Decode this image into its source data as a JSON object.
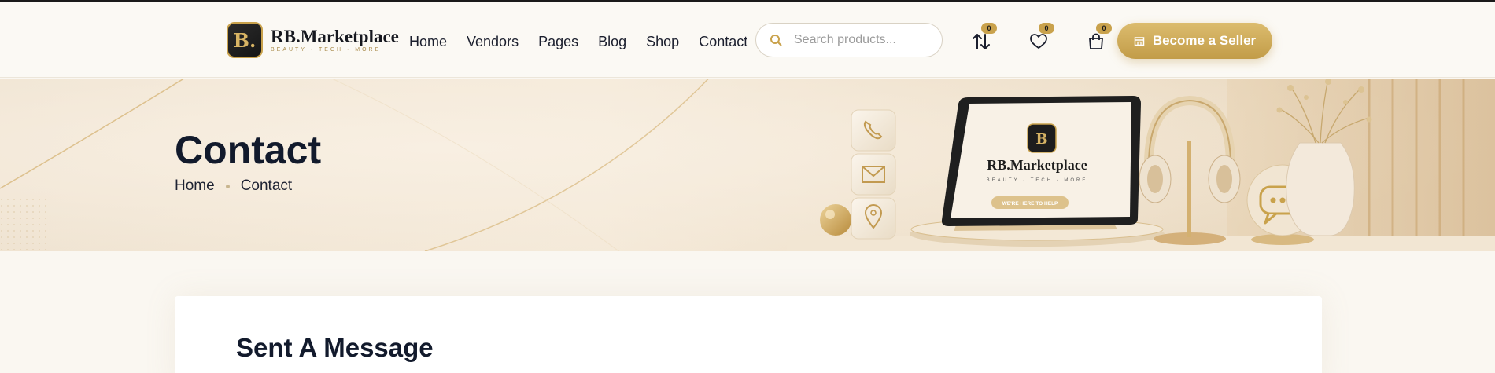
{
  "brand": {
    "initial": "B.",
    "name": "RB.Marketplace",
    "tagline": "BEAUTY · TECH · MORE"
  },
  "nav": {
    "items": [
      {
        "label": "Home"
      },
      {
        "label": "Vendors"
      },
      {
        "label": "Pages"
      },
      {
        "label": "Blog"
      },
      {
        "label": "Shop"
      },
      {
        "label": "Contact"
      }
    ]
  },
  "search": {
    "placeholder": "Search products...",
    "value": ""
  },
  "actions": {
    "compare_count": "0",
    "wishlist_count": "0",
    "cart_count": "0",
    "seller_label": "Become a Seller"
  },
  "hero": {
    "title": "Contact",
    "breadcrumb": [
      "Home",
      "Contact"
    ],
    "device_brand": "RB.Marketplace",
    "device_tagline": "BEAUTY · TECH · MORE",
    "device_button": "WE'RE HERE TO HELP"
  },
  "content": {
    "form_title": "Sent A Message"
  },
  "colors": {
    "accent_gold": "#c9a24c",
    "dark": "#121a2c",
    "page_bg": "#faf7f1"
  },
  "icons": [
    "search-icon",
    "compare-icon",
    "heart-icon",
    "bag-icon",
    "store-icon",
    "phone-icon",
    "mail-icon",
    "location-icon",
    "chat-icon"
  ]
}
